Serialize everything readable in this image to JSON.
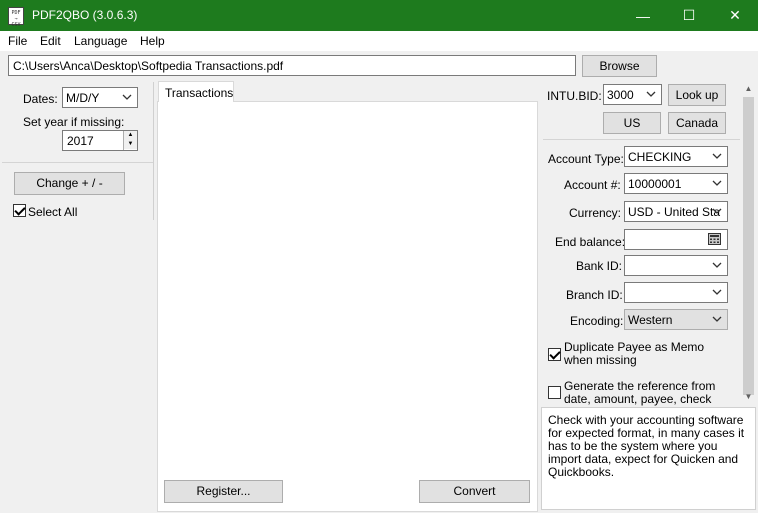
{
  "window": {
    "title": "PDF2QBO (3.0.6.3)",
    "icon_text": "PDF\n→\nCSV",
    "minimize_glyph": "—",
    "maximize_glyph": "☐",
    "close_glyph": "✕"
  },
  "menu": [
    "File",
    "Edit",
    "Language",
    "Help"
  ],
  "file": {
    "path": "C:\\Users\\Anca\\Desktop\\Softpedia Transactions.pdf",
    "browse_label": "Browse"
  },
  "left": {
    "dates_label": "Dates:",
    "dates_value": "M/D/Y",
    "set_year_label": "Set year if missing:",
    "year_value": "2017",
    "change_label": "Change + / -",
    "select_all_label": "Select All",
    "select_all_checked": true
  },
  "tabs": {
    "transactions_label": "Transactions",
    "register_label": "Register...",
    "convert_label": "Convert"
  },
  "right": {
    "intu_bid_label": "INTU.BID:",
    "intu_bid_value": "3000",
    "lookup_label": "Look up",
    "us_label": "US",
    "canada_label": "Canada",
    "account_type_label": "Account Type:",
    "account_type_value": "CHECKING",
    "account_num_label": "Account #:",
    "account_num_value": "10000001",
    "currency_label": "Currency:",
    "currency_value": "USD - United Sta",
    "end_balance_label": "End balance:",
    "end_balance_value": "",
    "bank_id_label": "Bank ID:",
    "bank_id_value": "",
    "branch_id_label": "Branch ID:",
    "branch_id_value": "",
    "encoding_label": "Encoding:",
    "encoding_value": "Western",
    "dup_payee_label": "Duplicate Payee as Memo when missing",
    "dup_payee_checked": true,
    "generate_ref_label": "Generate the reference from date, amount, payee, check",
    "generate_ref_checked": false
  },
  "help_text": "Check with your accounting software for expected format, in many cases it has to be the system where you import data, expect for Quicken and Quickbooks.",
  "colors": {
    "titlebar": "#1e7b1e",
    "button_face": "#e1e1e1"
  }
}
